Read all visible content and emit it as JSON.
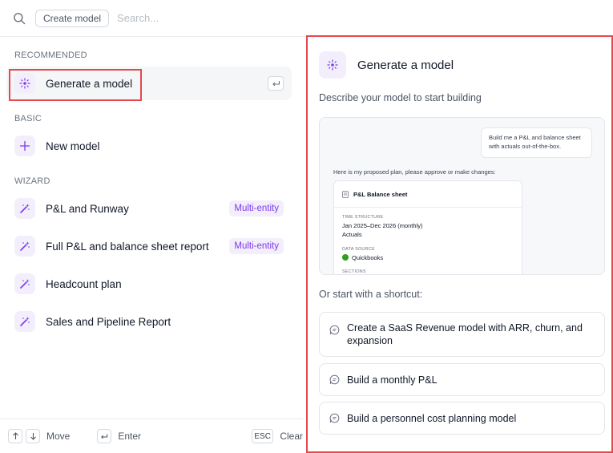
{
  "search": {
    "chip_label": "Create model",
    "placeholder": "Search..."
  },
  "sections": {
    "recommended": "RECOMMENDED",
    "basic": "BASIC",
    "wizard": "WIZARD"
  },
  "items": {
    "generate": {
      "label": "Generate a model",
      "icon": "sparkle-icon"
    },
    "new_model": {
      "label": "New model",
      "icon": "plus-icon"
    },
    "wizard": [
      {
        "label": "P&L and Runway",
        "badge": "Multi-entity",
        "icon": "magic-wand-icon"
      },
      {
        "label": "Full P&L and balance sheet report",
        "badge": "Multi-entity",
        "icon": "magic-wand-icon"
      },
      {
        "label": "Headcount plan",
        "badge": "",
        "icon": "magic-wand-icon"
      },
      {
        "label": "Sales and Pipeline Report",
        "badge": "",
        "icon": "magic-wand-icon"
      }
    ]
  },
  "footer": {
    "move": "Move",
    "enter": "Enter",
    "esc_key": "ESC",
    "clear": "Clear"
  },
  "panel": {
    "title": "Generate a model",
    "description": "Describe your model to start building",
    "preview": {
      "prompt_line1": "Build me a P&L and balance sheet",
      "prompt_line2": "with actuals out-of-the-box.",
      "plan_text": "Here is my proposed plan, please approve or make changes:",
      "card_title": "P&L Balance sheet",
      "time_structure_label": "TIME STRUCTURE",
      "time_structure_value": "Jan 2025–Dec 2026 (monthly)",
      "time_structure_value2": "Actuals",
      "data_source_label": "DATA SOURCE",
      "data_source_value": "Quickbooks",
      "sections_label": "SECTIONS"
    },
    "shortcut_heading": "Or start with a shortcut:",
    "shortcuts": [
      {
        "label_line1": "Create a SaaS Revenue model with ARR, churn, and",
        "label_line2": "expansion"
      },
      {
        "label_line1": "Build a monthly P&L",
        "label_line2": ""
      },
      {
        "label_line1": "Build a personnel cost planning model",
        "label_line2": ""
      }
    ]
  },
  "colors": {
    "accent": "#7c3aed",
    "accent_bg": "#f3eefc",
    "highlight": "#e5484d"
  }
}
